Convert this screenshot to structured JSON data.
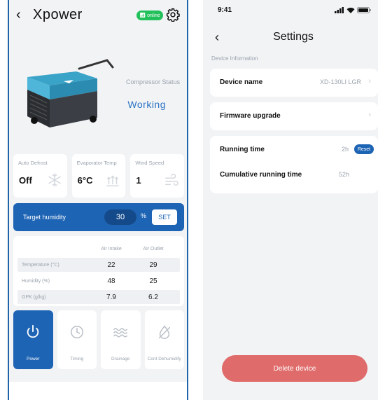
{
  "left": {
    "header": {
      "back_icon": "chevron-left-icon",
      "title": "Xpower",
      "status_badge": "online",
      "settings_icon": "gear-icon"
    },
    "device": {
      "status_label": "Compressor Status",
      "status_value": "Working"
    },
    "stats": [
      {
        "label": "Auto Defrost",
        "value": "Off",
        "icon": "snowflake-icon"
      },
      {
        "label": "Evaporator Temp",
        "value": "6°C",
        "icon": "heat-icon"
      },
      {
        "label": "Wind Speed",
        "value": "1",
        "icon": "wind-icon"
      }
    ],
    "humidity": {
      "label": "Target humidity",
      "value": "30",
      "unit": "%",
      "set_label": "SET"
    },
    "air_table": {
      "headers": [
        "",
        "Air Intake",
        "Air Outlet"
      ],
      "rows": [
        {
          "name": "Temperature (°C)",
          "intake": "22",
          "outlet": "29"
        },
        {
          "name": "Humidity (%)",
          "intake": "48",
          "outlet": "25"
        },
        {
          "name": "GPK (g/kg)",
          "intake": "7.9",
          "outlet": "6.2"
        }
      ]
    },
    "controls": [
      {
        "label": "Power",
        "icon": "power-icon",
        "active": true
      },
      {
        "label": "Timing",
        "icon": "clock-icon",
        "active": false
      },
      {
        "label": "Drainage",
        "icon": "waves-icon",
        "active": false
      },
      {
        "label": "Cont Dehumidify",
        "icon": "no-drop-icon",
        "active": false
      }
    ]
  },
  "right": {
    "status_bar": {
      "time": "9:41"
    },
    "header": {
      "back_icon": "chevron-left-icon",
      "title": "Settings"
    },
    "section_label": "Device Information",
    "device_name": {
      "label": "Device name",
      "value": "XD-130LI LGR"
    },
    "firmware": {
      "label": "Firmware upgrade"
    },
    "running_time": {
      "label": "Running time",
      "value": "2h",
      "reset_label": "Reset"
    },
    "cumulative": {
      "label": "Cumulative running time",
      "value": "52h"
    },
    "delete_label": "Delete device"
  },
  "colors": {
    "accent": "#1e64b4",
    "online": "#22c05a",
    "danger": "#e06b6b",
    "muted": "#9aa3ae"
  }
}
